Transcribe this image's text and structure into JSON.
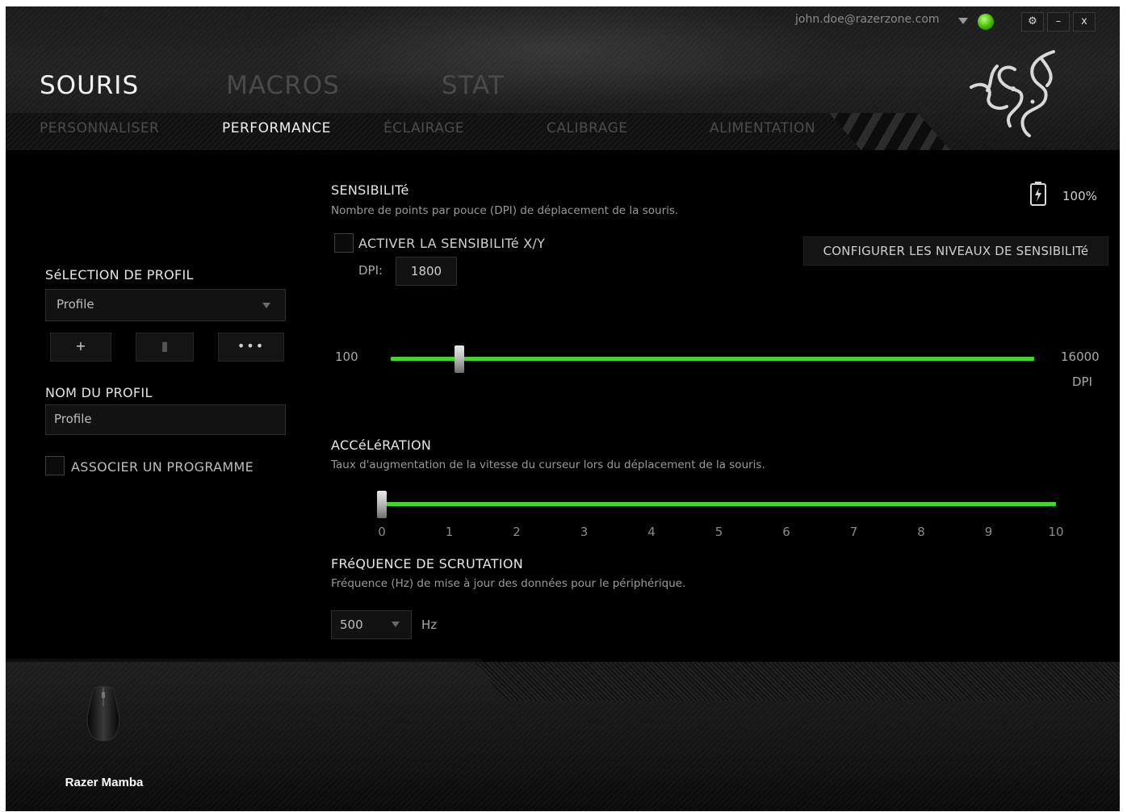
{
  "header": {
    "account_email": "john.doe@razerzone.com",
    "main_tabs": [
      "SOURIS",
      "MACROS",
      "STAT"
    ],
    "sub_tabs": [
      "PERSONNALISER",
      "PERFORMANCE",
      "ÉCLAIRAGE",
      "CALIBRAGE",
      "ALIMENTATION"
    ],
    "window_buttons": {
      "settings": "⚙",
      "minimize": "–",
      "close": "x"
    },
    "accent_color": "#44d62c"
  },
  "sidebar": {
    "profile_selection_title": "SéLECTION DE PROFIL",
    "profile_dropdown_value": "Profile",
    "profile_buttons": {
      "add": "+",
      "delete": "▮",
      "more": "•••"
    },
    "profile_name_title": "NOM DU PROFIL",
    "profile_name_value": "Profile",
    "associate_program_label": "ASSOCIER UN PROGRAMME"
  },
  "battery": {
    "level": "100%"
  },
  "sensitivity": {
    "title": "SENSIBILITé",
    "description": "Nombre de points par pouce (DPI) de déplacement de la souris.",
    "xy_label": "ACTIVER LA SENSIBILITé X/Y",
    "dpi_label": "DPI:",
    "dpi_value": "1800",
    "config_button": "CONFIGURER LES NIVEAUX DE SENSIBILITé",
    "min_label": "100",
    "max_label": "16000",
    "unit_label": "DPI",
    "slider_value": 1800,
    "slider_min": 100,
    "slider_max": 16000
  },
  "acceleration": {
    "title": "ACCéLéRATION",
    "description": "Taux d'augmentation de la vitesse du curseur lors du déplacement de la souris.",
    "value": 0,
    "ticks": [
      "0",
      "1",
      "2",
      "3",
      "4",
      "5",
      "6",
      "7",
      "8",
      "9",
      "10"
    ]
  },
  "polling": {
    "title": "FRéQUENCE DE SCRUTATION",
    "description": "Fréquence (Hz) de mise à jour des données pour le périphérique.",
    "value": "500",
    "unit": "Hz"
  },
  "footer": {
    "device_name": "Razer Mamba"
  }
}
